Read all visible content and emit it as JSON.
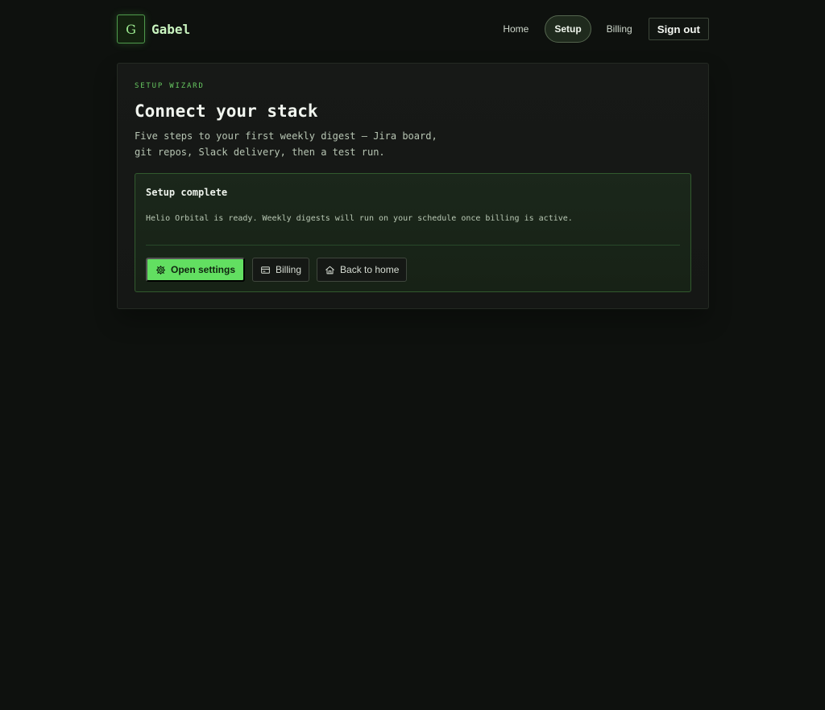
{
  "brand": {
    "logo_letter": "G",
    "name": "Gabel"
  },
  "nav": {
    "home": "Home",
    "setup": "Setup",
    "billing": "Billing",
    "sign_out": "Sign out"
  },
  "wizard": {
    "kicker": "SETUP WIZARD",
    "title": "Connect your stack",
    "description_line_1": "Five steps to your first weekly digest — Jira board,",
    "description_line_2": "git repos, Slack delivery, then a test run."
  },
  "complete": {
    "title": "Setup complete",
    "message": "Helio Orbital is ready. Weekly digests will run on your schedule once billing is active.",
    "actions": {
      "open_settings": "Open settings",
      "billing": "Billing",
      "back_home": "Back to home"
    }
  },
  "icons": {
    "open_settings": "gear-icon",
    "billing": "card-icon",
    "back_home": "home-icon"
  },
  "colors": {
    "background": "#0e110e",
    "accent": "#62df61",
    "panel": "#161716",
    "success_panel": "#192419"
  }
}
